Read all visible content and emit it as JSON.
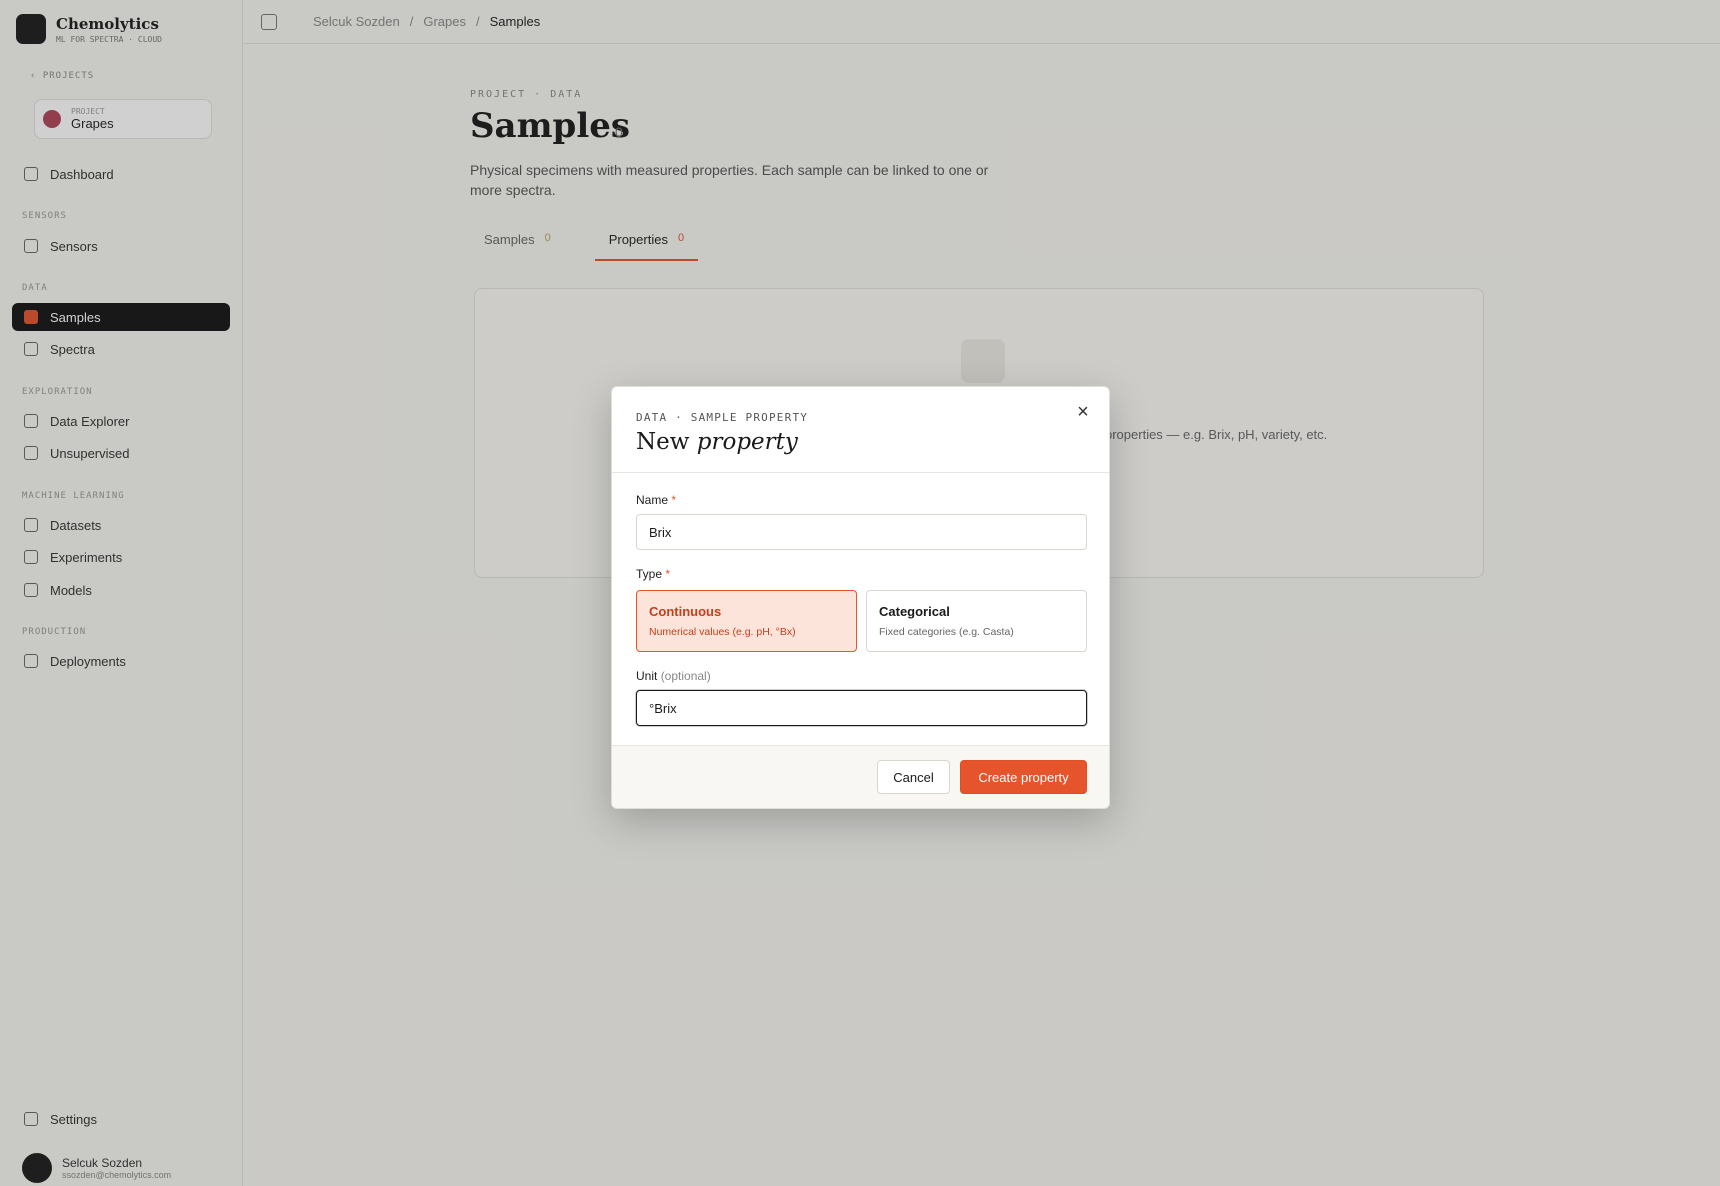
{
  "app": {
    "brand_name": "Chemolytics",
    "brand_sub": "ML FOR SPECTRA · CLOUD"
  },
  "sidebar": {
    "projects_label": "PROJECTS",
    "project_card": {
      "label": "PROJECT",
      "name": "Grapes"
    },
    "items": [
      {
        "label": "Dashboard",
        "icon": "home-icon"
      },
      {
        "section": "SENSORS"
      },
      {
        "label": "Sensors",
        "icon": "sensor-icon"
      },
      {
        "section": "DATA"
      },
      {
        "label": "Samples",
        "icon": "samples-icon",
        "active": true
      },
      {
        "label": "Spectra",
        "icon": "spectra-icon"
      },
      {
        "section": "EXPLORATION"
      },
      {
        "label": "Data Explorer",
        "icon": "explorer-icon"
      },
      {
        "label": "Unsupervised",
        "icon": "unsupervised-icon"
      },
      {
        "section": "MACHINE LEARNING"
      },
      {
        "label": "Datasets",
        "icon": "datasets-icon"
      },
      {
        "label": "Experiments",
        "icon": "experiments-icon"
      },
      {
        "label": "Models",
        "icon": "models-icon"
      },
      {
        "section": "PRODUCTION"
      },
      {
        "label": "Deployments",
        "icon": "deployments-icon"
      }
    ],
    "settings_label": "Settings",
    "user": {
      "name": "Selcuk Sozden",
      "email": "ssozden@chemolytics.com"
    }
  },
  "topbar": {
    "breadcrumb": [
      "Selcuk Sozden",
      "Grapes",
      "Samples"
    ]
  },
  "page": {
    "eyebrow": "PROJECT · DATA",
    "title": "Samples",
    "count": "0",
    "description": "Physical specimens with measured properties. Each sample can be linked to one or more spectra.",
    "tabs": [
      {
        "label": "Samples",
        "count": "0"
      },
      {
        "label": "Properties",
        "count": "0",
        "active": true
      }
    ],
    "empty_text": "properties — e.g. Brix, pH, variety, etc."
  },
  "modal": {
    "eyebrow": "DATA · SAMPLE PROPERTY",
    "title_plain": "New",
    "title_italic": "property",
    "close_icon": "×",
    "name_label": "Name",
    "required_mark": "*",
    "name_value": "Brix",
    "type_label": "Type",
    "types": [
      {
        "title": "Continuous",
        "desc": "Numerical values (e.g. pH, °Bx)",
        "selected": true
      },
      {
        "title": "Categorical",
        "desc": "Fixed categories (e.g. Casta)",
        "selected": false
      }
    ],
    "unit_label": "Unit",
    "unit_optional": "(optional)",
    "unit_value": "°Brix",
    "cancel_label": "Cancel",
    "create_label": "Create property"
  },
  "colors": {
    "accent": "#e5542b",
    "selected_bg": "#fde4da",
    "overlay": "rgba(40,40,40,0.22)"
  }
}
